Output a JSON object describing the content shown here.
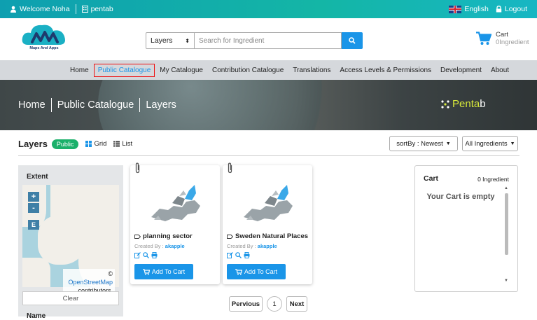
{
  "topbar": {
    "welcome": "Welcome Noha",
    "org": "pentab",
    "language": "English",
    "logout": "Logout"
  },
  "header": {
    "logo_text": "Maps And Apps",
    "search_type": "Layers",
    "search_placeholder": "Search for Ingredient",
    "cart_label": "Cart",
    "cart_sub": "0Ingredient"
  },
  "nav": [
    "Home",
    "Public Catalogue",
    "My Catalogue",
    "Contribution Catalogue",
    "Translations",
    "Access Levels & Permissions",
    "Development",
    "About"
  ],
  "banner": {
    "crumbs": [
      "Home",
      "Public Catalogue",
      "Layers"
    ],
    "brand_a": "Penta",
    "brand_b": "b"
  },
  "page": {
    "title": "Layers",
    "badge": "Public",
    "grid": "Grid",
    "list": "List",
    "sort": "sortBy : Newest",
    "filter": "All Ingredients"
  },
  "sidebar": {
    "extent": "Extent",
    "zoom_in": "+",
    "zoom_out": "-",
    "extent_btn": "E",
    "attrib_pre": "©",
    "attrib_link": "OpenStreetMap",
    "attrib_post": "contributors.",
    "clear": "Clear",
    "name": "Name"
  },
  "cards": [
    {
      "title": "planning sector",
      "created_by": "Created By :",
      "author": "akapple",
      "add": "Add To Cart"
    },
    {
      "title": "Sweden Natural Places",
      "created_by": "Created By :",
      "author": "akapple",
      "add": "Add To Cart"
    }
  ],
  "pagination": {
    "prev": "Pervious",
    "current": "1",
    "next": "Next"
  },
  "cart_panel": {
    "title": "Cart",
    "count": "0 Ingredient",
    "empty": "Your Cart is empty"
  },
  "colors": {
    "accent": "#1a95e8",
    "topbar": "#14b6a6",
    "badge": "#1bb06a",
    "active_border": "#e11111"
  }
}
